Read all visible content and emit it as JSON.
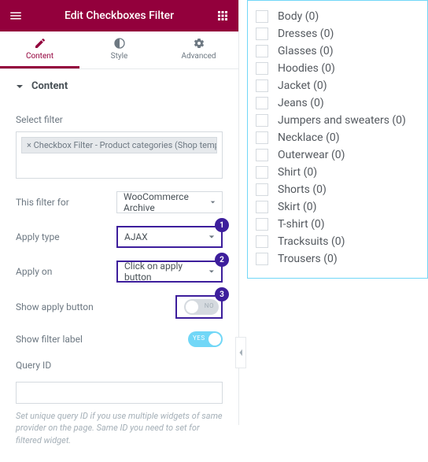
{
  "header": {
    "title": "Edit Checkboxes Filter"
  },
  "tabs": {
    "content": "Content",
    "style": "Style",
    "advanced": "Advanced"
  },
  "section": {
    "content": "Content"
  },
  "controls": {
    "select_filter_label": "Select filter",
    "selected_token": "× Checkbox Filter - Product categories (Shop template)",
    "this_filter_for_label": "This filter for",
    "this_filter_for_value": "WooCommerce Archive",
    "apply_type_label": "Apply type",
    "apply_type_value": "AJAX",
    "apply_on_label": "Apply on",
    "apply_on_value": "Click on apply button",
    "show_apply_button_label": "Show apply button",
    "show_apply_button_value": "NO",
    "show_filter_label_label": "Show filter label",
    "show_filter_label_value": "YES",
    "query_id_label": "Query ID",
    "query_id_hint": "Set unique query ID if you use multiple widgets of same provider on the page. Same ID you need to set for filtered widget."
  },
  "badges": {
    "b1": "1",
    "b2": "2",
    "b3": "3"
  },
  "filter_items": [
    {
      "label": "Body (0)"
    },
    {
      "label": "Dresses (0)"
    },
    {
      "label": "Glasses (0)"
    },
    {
      "label": "Hoodies (0)"
    },
    {
      "label": "Jacket (0)"
    },
    {
      "label": "Jeans (0)"
    },
    {
      "label": "Jumpers and sweaters (0)"
    },
    {
      "label": "Necklace (0)"
    },
    {
      "label": "Outerwear (0)"
    },
    {
      "label": "Shirt (0)"
    },
    {
      "label": "Shorts (0)"
    },
    {
      "label": "Skirt (0)"
    },
    {
      "label": "T-shirt (0)"
    },
    {
      "label": "Tracksuits (0)"
    },
    {
      "label": "Trousers (0)"
    }
  ]
}
